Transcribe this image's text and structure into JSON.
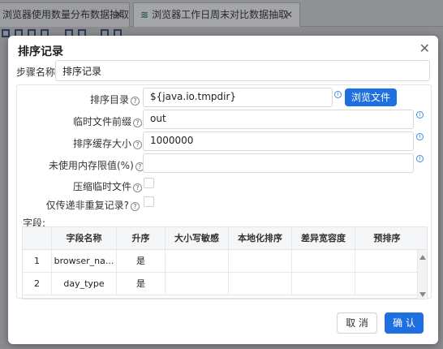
{
  "tabs": [
    {
      "label": "浏览器使用数量分布数据抽取",
      "close": "✕"
    },
    {
      "label": "浏览器工作日周末对比数据抽取",
      "close": "✕"
    }
  ],
  "dialog": {
    "title": "排序记录",
    "close": "✕",
    "step_label": "步骤名称:",
    "step_value": "排序记录",
    "fields": {
      "sort_dir_label": "排序目录",
      "sort_dir_value": "${java.io.tmpdir}",
      "browse_label": "浏览文件",
      "tmp_prefix_label": "临时文件前缀",
      "tmp_prefix_value": "out",
      "cache_size_label": "排序缓存大小",
      "cache_size_value": "1000000",
      "mem_limit_label": "未使用内存限值(%)",
      "mem_limit_value": "",
      "compress_label": "压缩临时文件",
      "unique_label": "仅传递非重复记录?"
    },
    "fields_section_label": "字段:",
    "table": {
      "columns": [
        "",
        "字段名称",
        "升序",
        "大小写敏感",
        "本地化排序",
        "差异宽容度",
        "预排序"
      ],
      "rows": [
        [
          "1",
          "browser_na...",
          "是",
          "",
          "",
          "",
          ""
        ],
        [
          "2",
          "day_type",
          "是",
          "",
          "",
          "",
          ""
        ]
      ]
    },
    "cancel_label": "取 消",
    "ok_label": "确 认"
  }
}
